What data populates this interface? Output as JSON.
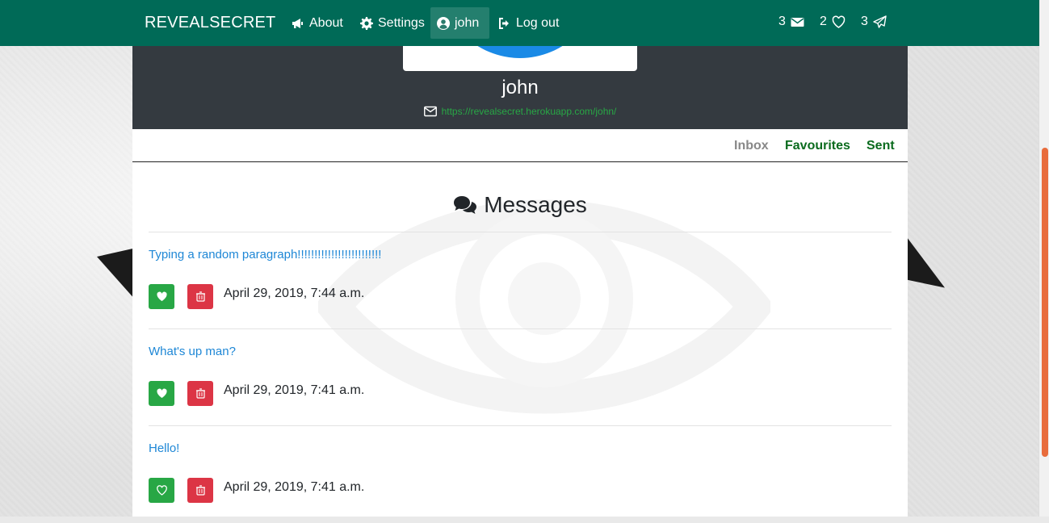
{
  "navbar": {
    "brand": "REVEALSECRET",
    "items": [
      {
        "label": "About",
        "icon": "bullhorn-icon"
      },
      {
        "label": "Settings",
        "icon": "gear-icon"
      },
      {
        "label": "john",
        "icon": "user-circle-icon",
        "active": true
      },
      {
        "label": "Log out",
        "icon": "sign-out-icon"
      }
    ],
    "counts": [
      {
        "value": "3",
        "icon": "envelope-icon"
      },
      {
        "value": "2",
        "icon": "heart-outline-icon"
      },
      {
        "value": "3",
        "icon": "paper-plane-icon"
      }
    ]
  },
  "profile": {
    "name": "john",
    "link": "https://revealsecret.herokuapp.com/john/"
  },
  "tabs": [
    {
      "label": "Inbox",
      "state": "inactive"
    },
    {
      "label": "Favourites",
      "state": "active"
    },
    {
      "label": "Sent",
      "state": "active"
    }
  ],
  "messages_title": "Messages",
  "messages": [
    {
      "text": "Typing a random paragraph!!!!!!!!!!!!!!!!!!!!!!!!!",
      "date": "April 29, 2019, 7:44 a.m.",
      "favourited": true
    },
    {
      "text": "What's up man?",
      "date": "April 29, 2019, 7:41 a.m.",
      "favourited": true
    },
    {
      "text": "Hello!",
      "date": "April 29, 2019, 7:41 a.m.",
      "favourited": false
    }
  ],
  "colors": {
    "navbar": "#006a57",
    "header": "#343a40",
    "avatar": "#1a8ae6",
    "like_button": "#28a745",
    "delete_button": "#dc3545",
    "message_text": "#1e87d6",
    "profile_link": "#28a745",
    "tab_active": "#0b6b1e"
  }
}
